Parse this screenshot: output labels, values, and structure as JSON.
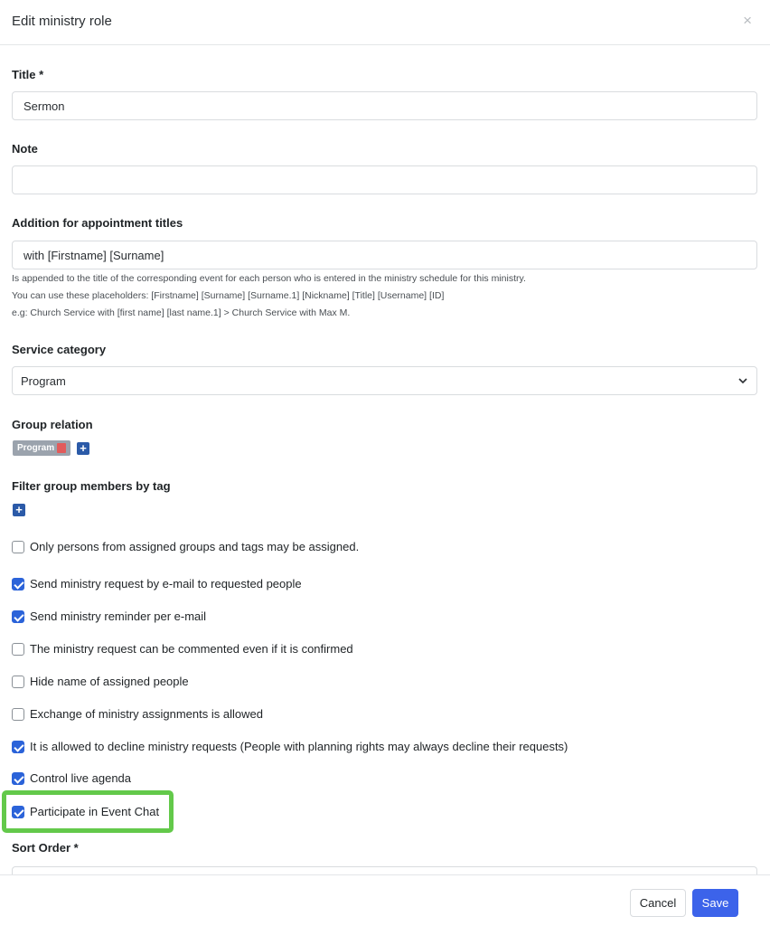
{
  "dialog": {
    "title": "Edit ministry role",
    "close_icon": "×"
  },
  "fields": {
    "title_label": "Title *",
    "title_value": "Sermon",
    "note_label": "Note",
    "note_value": "",
    "addition_label": "Addition for appointment titles",
    "addition_value": "with [Firstname] [Surname]",
    "addition_help": [
      "Is appended to the title of the corresponding event for each person who is entered in the ministry schedule for this ministry.",
      "You can use these placeholders: [Firstname] [Surname] [Surname.1] [Nickname] [Title] [Username] [ID]",
      "e.g: Church Service with [first name] [last name.1] > Church Service with Max M."
    ],
    "service_category_label": "Service category",
    "service_category_value": "Program",
    "group_relation_label": "Group relation",
    "group_chip": "Program",
    "filter_label": "Filter group members by tag",
    "sort_order_label": "Sort Order *"
  },
  "checkboxes": [
    {
      "label": "Only persons from assigned groups and tags may be assigned.",
      "checked": false
    },
    {
      "label": "Send ministry request by e-mail to requested people",
      "checked": true
    },
    {
      "label": "Send ministry reminder per e-mail",
      "checked": true
    },
    {
      "label": "The ministry request can be commented even if it is confirmed",
      "checked": false
    },
    {
      "label": "Hide name of assigned people",
      "checked": false
    },
    {
      "label": "Exchange of ministry assignments is allowed",
      "checked": false
    },
    {
      "label": "It is allowed to decline ministry requests (People with planning rights may always decline their requests)",
      "checked": true
    },
    {
      "label": "Control live agenda",
      "checked": true
    },
    {
      "label": "Participate in Event Chat",
      "checked": true
    }
  ],
  "footer": {
    "cancel_label": "Cancel",
    "save_label": "Save"
  },
  "colors": {
    "accent": "#3c63ea",
    "highlight": "#63c94a",
    "chip": "#9ba3ad"
  }
}
